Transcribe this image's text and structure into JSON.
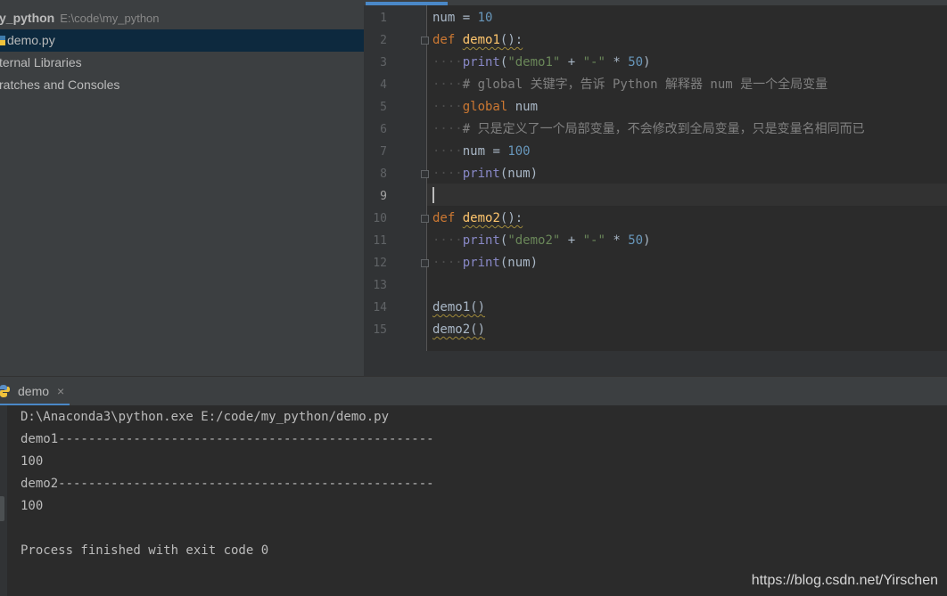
{
  "project": {
    "root_name": "y_python",
    "root_path": "E:\\code\\my_python",
    "items": [
      {
        "label": "demo.py",
        "selected": true,
        "icon": "python-file-icon"
      },
      {
        "label": "ternal Libraries",
        "selected": false
      },
      {
        "label": "ratches and Consoles",
        "selected": false
      }
    ]
  },
  "editor": {
    "current_line": 9,
    "line_numbers": [
      "1",
      "2",
      "3",
      "4",
      "5",
      "6",
      "7",
      "8",
      "9",
      "10",
      "11",
      "12",
      "13",
      "14",
      "15"
    ]
  },
  "code": {
    "l1": {
      "var": "num",
      "eq": " = ",
      "val": "10"
    },
    "l2": {
      "kw": "def",
      "name": "demo1",
      "paren": "():"
    },
    "l3": {
      "fn": "print",
      "open": "(",
      "str1": "\"demo1\"",
      "plus": " + ",
      "str2": "\"-\"",
      "mul": " * ",
      "n": "50",
      "close": ")"
    },
    "l4": {
      "text": "# global 关键字，告诉 Python 解释器 num 是一个全局变量"
    },
    "l5": {
      "kw": "global",
      "var": " num"
    },
    "l6": {
      "text": "# 只是定义了一个局部变量，不会修改到全局变量，只是变量名相同而已"
    },
    "l7": {
      "var": "num",
      "eq": " = ",
      "val": "100"
    },
    "l8": {
      "fn": "print",
      "arg": "(num)"
    },
    "l10": {
      "kw": "def",
      "name": "demo2",
      "paren": "():"
    },
    "l11": {
      "fn": "print",
      "open": "(",
      "str1": "\"demo2\"",
      "plus": " + ",
      "str2": "\"-\"",
      "mul": " * ",
      "n": "50",
      "close": ")"
    },
    "l12": {
      "fn": "print",
      "arg": "(num)"
    },
    "l14": {
      "call": "demo1",
      "paren": "()"
    },
    "l15": {
      "call": "demo2",
      "paren": "()"
    }
  },
  "run": {
    "tab_label": "demo",
    "close_glyph": "×",
    "tab_icon": "python-run-icon",
    "output": [
      "D:\\Anaconda3\\python.exe E:/code/my_python/demo.py",
      "demo1--------------------------------------------------",
      "100",
      "demo2--------------------------------------------------",
      "100",
      "",
      "Process finished with exit code 0"
    ]
  },
  "watermark": "https://blog.csdn.net/Yirschen",
  "colors": {
    "keyword": "#cc7832",
    "function": "#ffc66d",
    "builtin": "#8888c6",
    "string": "#6a8759",
    "number": "#6897bb",
    "comment": "#808080",
    "selection": "#0d293e",
    "accent": "#4a88c7"
  }
}
